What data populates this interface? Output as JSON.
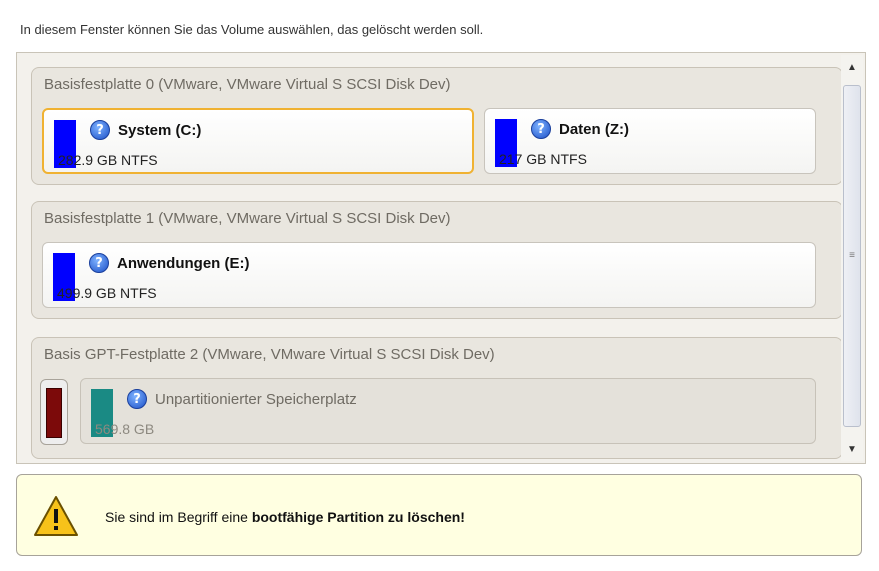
{
  "instruction": "In diesem Fenster können Sie das Volume auswählen, das gelöscht werden soll.",
  "disks": [
    {
      "title": "Basisfestplatte 0 (VMware, VMware Virtual S SCSI Disk Dev)",
      "partitions": [
        {
          "name": "System (C:)",
          "info": "282.9 GB NTFS",
          "color": "#0000ff",
          "selected": true
        },
        {
          "name": "Daten (Z:)",
          "info": "217 GB NTFS",
          "color": "#0000ff",
          "selected": false
        }
      ]
    },
    {
      "title": "Basisfestplatte 1 (VMware, VMware Virtual S SCSI Disk Dev)",
      "partitions": [
        {
          "name": "Anwendungen (E:)",
          "info": "499.9 GB NTFS",
          "color": "#0000ff",
          "selected": false
        }
      ]
    },
    {
      "title": "Basis GPT-Festplatte 2 (VMware, VMware Virtual S SCSI Disk Dev)",
      "partitions": [
        {
          "name": "",
          "info": "",
          "color": "#7c0a0a",
          "selected": false
        },
        {
          "name": "Unpartitionierter Speicherplatz",
          "info": "569.8 GB",
          "color": "#1a8a84",
          "selected": false
        }
      ]
    }
  ],
  "icons": {
    "help": "question-help-icon",
    "warning": "warning-triangle-icon"
  },
  "help_glyph": "?",
  "warning": {
    "text_prefix": "Sie sind im Begriff eine ",
    "text_bold": "bootfähige Partition zu löschen!"
  },
  "colors": {
    "selection_border": "#f0b232",
    "warning_background": "#ffffe1"
  }
}
